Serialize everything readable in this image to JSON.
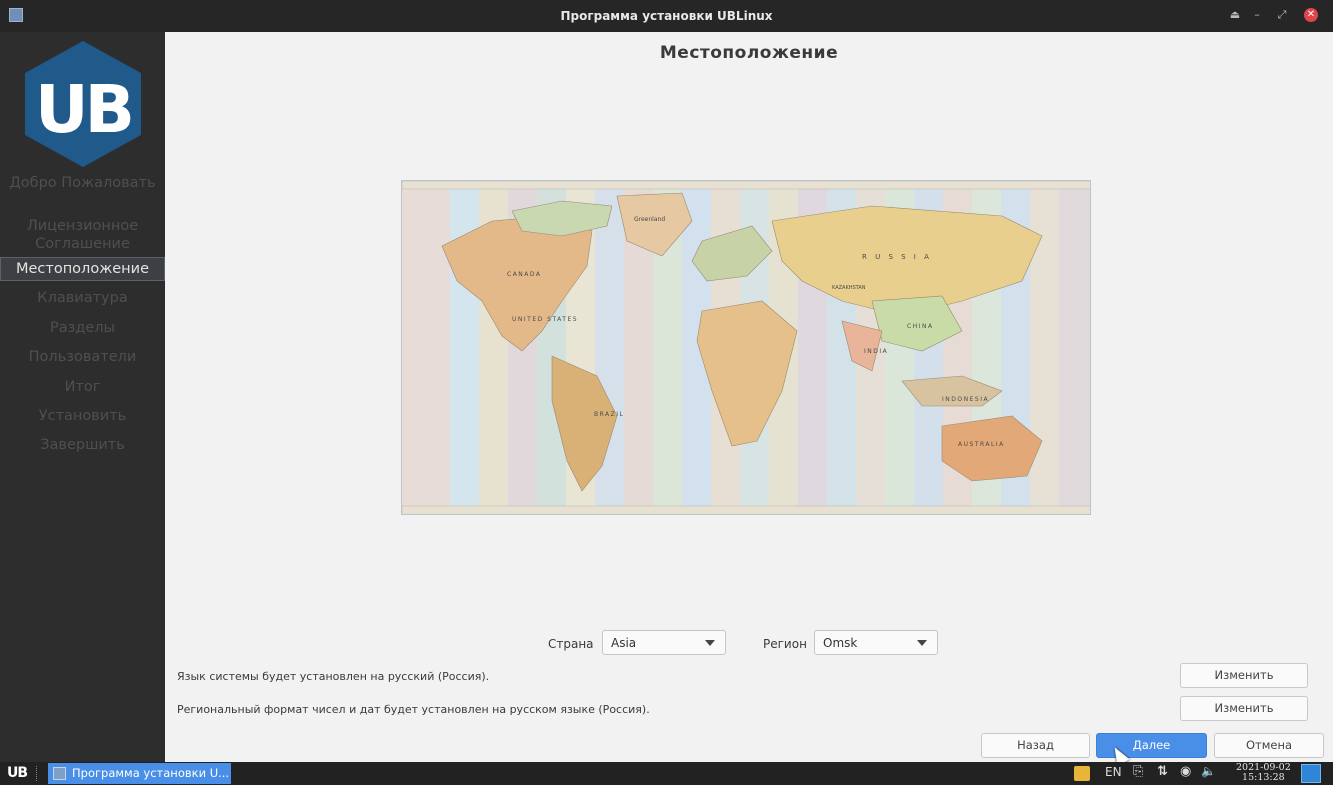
{
  "window": {
    "title": "Программа установки UBLinux",
    "controls": [
      "eject-icon",
      "minimize-icon",
      "maximize-icon",
      "close-icon"
    ]
  },
  "sidebar": {
    "logo_text": "UB",
    "items": [
      {
        "label": "Добро Пожаловать",
        "active": false
      },
      {
        "label": "Лицензионное Соглашение",
        "active": false
      },
      {
        "label": "Местоположение",
        "active": true
      },
      {
        "label": "Клавиатура",
        "active": false
      },
      {
        "label": "Разделы",
        "active": false
      },
      {
        "label": "Пользователи",
        "active": false
      },
      {
        "label": "Итог",
        "active": false
      },
      {
        "label": "Установить",
        "active": false
      },
      {
        "label": "Завершить",
        "active": false
      }
    ]
  },
  "main": {
    "title": "Местоположение",
    "map": {
      "labels": [
        "CANADA",
        "UNITED STATES",
        "Greenland",
        "BRAZIL",
        "R U S S I A",
        "CHINA",
        "INDIA",
        "AUSTRALIA",
        "INDONESIA",
        "KAZAKHSTAN"
      ]
    },
    "country": {
      "label": "Страна",
      "value": "Asia"
    },
    "region": {
      "label": "Регион",
      "value": "Omsk"
    },
    "language_info": "Язык системы будет установлен на русский (Россия).",
    "format_info": "Региональный формат чисел и дат будет установлен на русском языке (Россия).",
    "change_label": "Изменить",
    "back_label": "Назад",
    "next_label": "Далее",
    "cancel_label": "Отмена"
  },
  "taskbar": {
    "logo": "UB",
    "task_label": "Программа установки U...",
    "lang": "EN",
    "date": "2021-09-02",
    "time": "15:13:28"
  },
  "colors": {
    "accent": "#4a8fe7",
    "sidebar_bg": "#2d2d2d",
    "logo_hex": "#1f5a8a"
  }
}
